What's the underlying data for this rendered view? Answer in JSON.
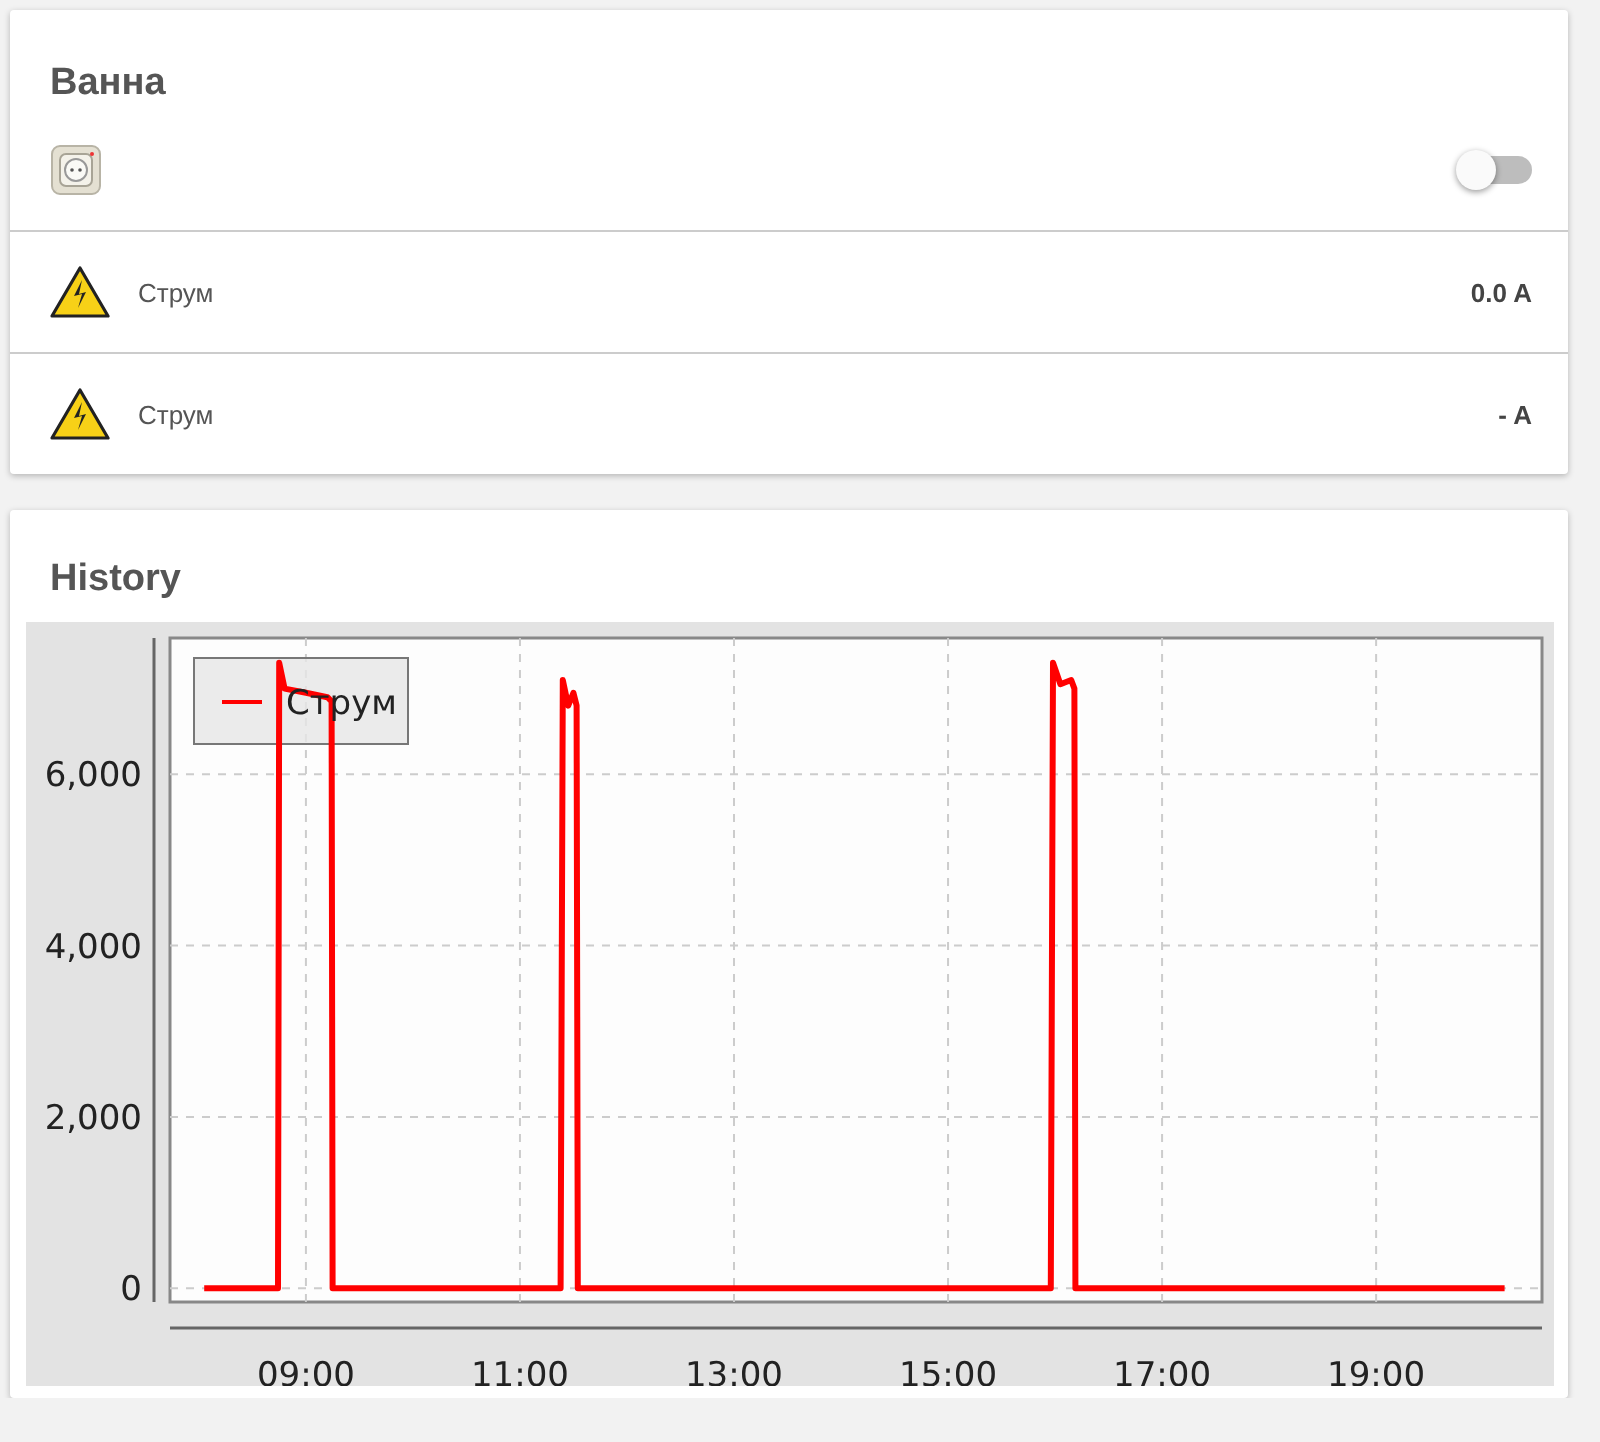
{
  "device_card": {
    "title": "Ванна",
    "switch": {
      "on": false
    },
    "sensors": [
      {
        "label": "Струм",
        "value": "0.0 A"
      },
      {
        "label": "Струм",
        "value": "- A"
      }
    ]
  },
  "history_card": {
    "title": "History",
    "chart_data": {
      "type": "line",
      "x": [
        8.05,
        8.74,
        8.75,
        8.8,
        9.0,
        9.2,
        9.24,
        9.25,
        11.38,
        11.4,
        11.45,
        11.5,
        11.53,
        11.54,
        15.96,
        15.98,
        16.05,
        16.15,
        16.18,
        16.19,
        20.2
      ],
      "series": [
        {
          "name": "Струм",
          "color": "#ff0000",
          "values": [
            0,
            0,
            7300,
            7000,
            6950,
            6900,
            6850,
            0,
            0,
            7100,
            6800,
            6950,
            6800,
            0,
            0,
            7300,
            7050,
            7100,
            7000,
            0,
            0
          ]
        }
      ],
      "grid": true,
      "xlim": [
        7.73,
        20.55
      ],
      "ylim": [
        -160,
        7590
      ],
      "xticks": [
        {
          "value": 9,
          "label": "09:00"
        },
        {
          "value": 11,
          "label": "11:00"
        },
        {
          "value": 13,
          "label": "13:00"
        },
        {
          "value": 15,
          "label": "15:00"
        },
        {
          "value": 17,
          "label": "17:00"
        },
        {
          "value": 19,
          "label": "19:00"
        }
      ],
      "yticks": [
        {
          "value": 0,
          "label": "0"
        },
        {
          "value": 2000,
          "label": "2,000"
        },
        {
          "value": 4000,
          "label": "4,000"
        },
        {
          "value": 6000,
          "label": "6,000"
        }
      ]
    }
  }
}
